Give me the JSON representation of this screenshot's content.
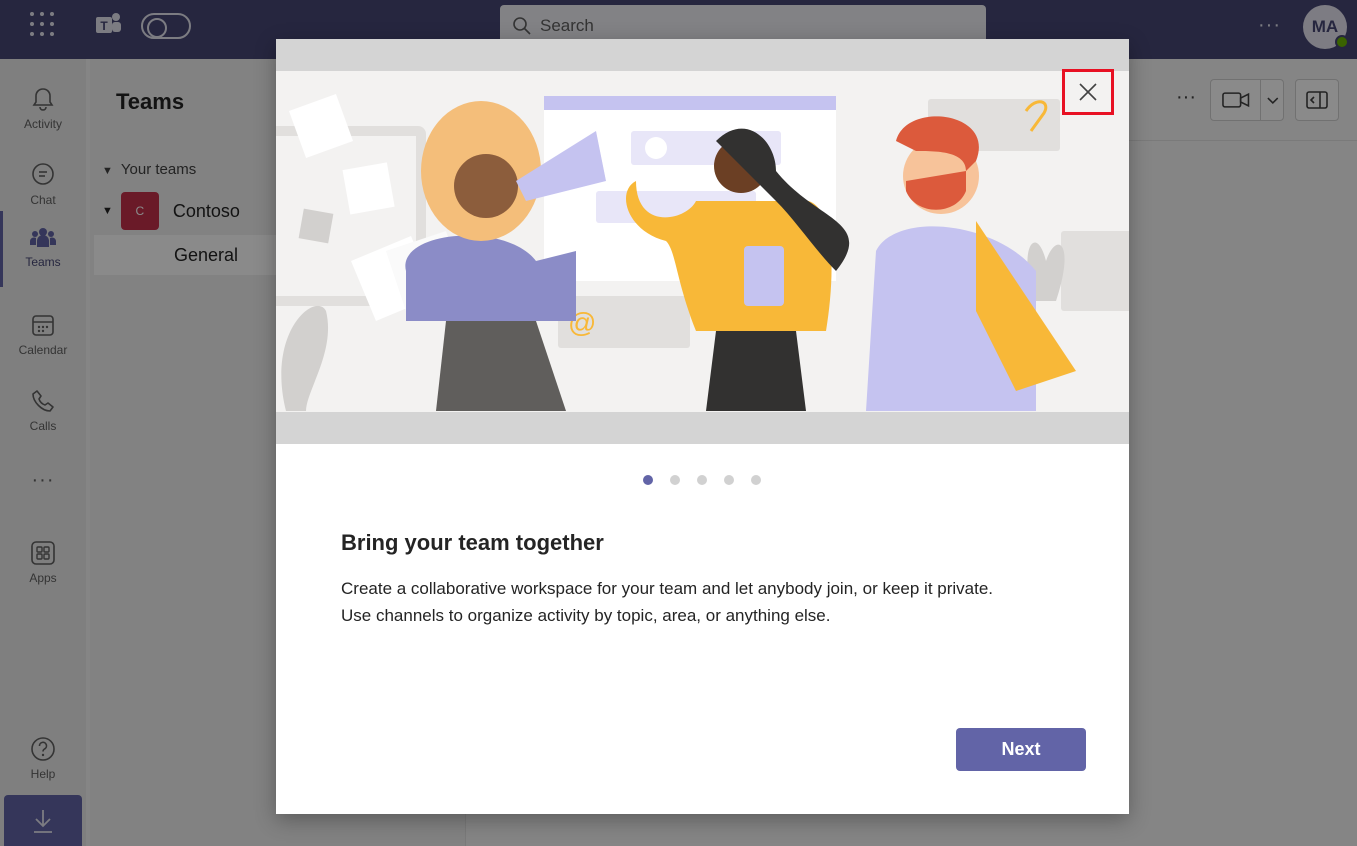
{
  "topbar": {
    "search_placeholder": "Search",
    "more_label": "···",
    "avatar_initials": "MA"
  },
  "rail": {
    "items": [
      {
        "label": "Activity",
        "icon": "bell-icon"
      },
      {
        "label": "Chat",
        "icon": "chat-icon"
      },
      {
        "label": "Teams",
        "icon": "teams-icon"
      },
      {
        "label": "Calendar",
        "icon": "calendar-icon"
      },
      {
        "label": "Calls",
        "icon": "phone-icon"
      },
      {
        "label": "···",
        "icon": "more-icon"
      },
      {
        "label": "Apps",
        "icon": "apps-icon"
      },
      {
        "label": "Help",
        "icon": "help-icon"
      }
    ],
    "active": "Teams"
  },
  "teams_panel": {
    "title": "Teams",
    "section_label": "Your teams",
    "team_initial": "C",
    "team_name": "Contoso",
    "channel_name": "General"
  },
  "main_header": {
    "more_label": "···"
  },
  "dialog": {
    "title": "Bring your team together",
    "body_line1": "Create a collaborative workspace for your team and let anybody join, or keep it private.",
    "body_line2": "Use channels to organize activity by topic, area, or anything else.",
    "next_label": "Next",
    "page_count": 5,
    "current_page": 1
  },
  "colors": {
    "topbar": "#464775",
    "accent": "#6264a7",
    "close_highlight": "#e81123"
  }
}
